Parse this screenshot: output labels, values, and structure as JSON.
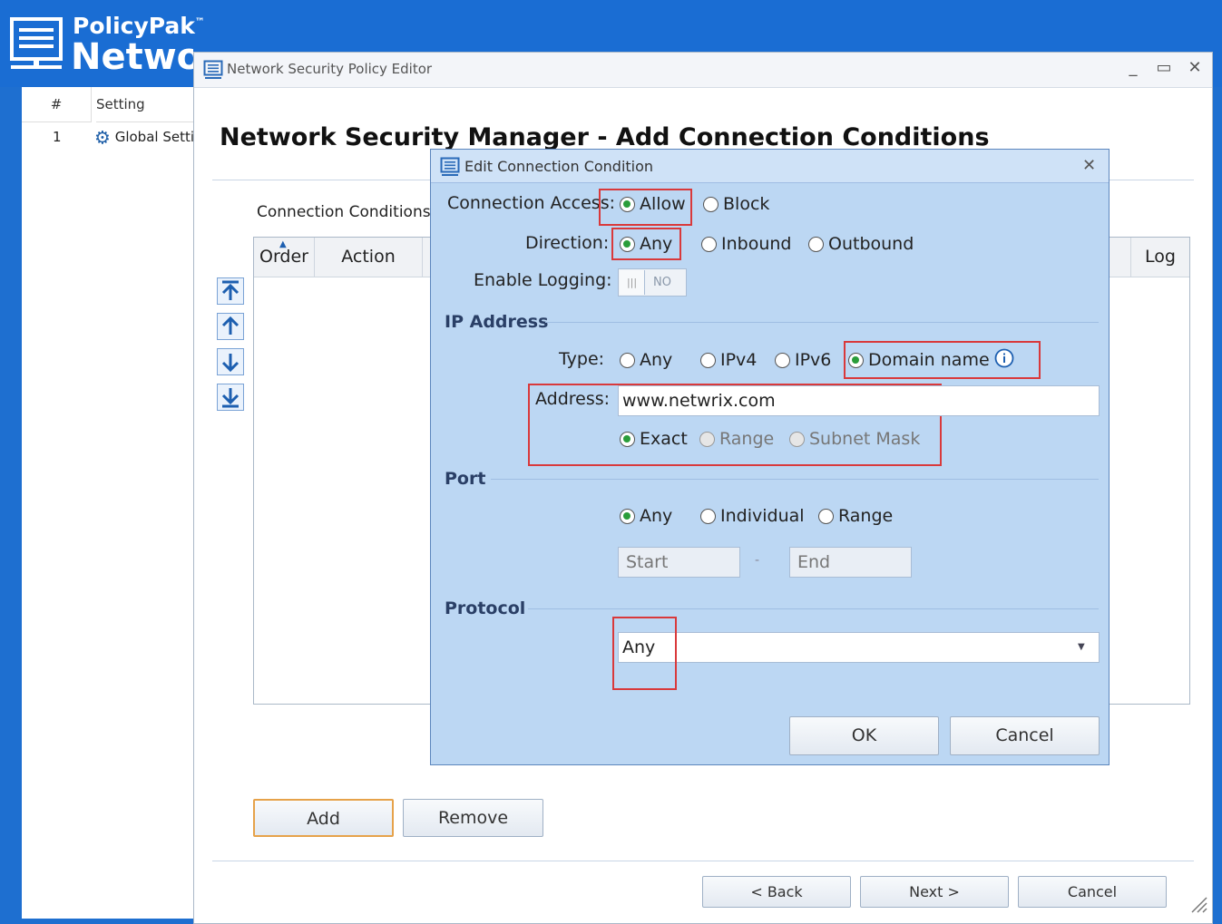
{
  "app": {
    "brand": "PolicyPak",
    "brand_tm": "™",
    "title": "Network Security Manager",
    "table_headers": [
      "#",
      "Setting"
    ],
    "row_number": "1",
    "row_setting": "Global Settings"
  },
  "window": {
    "title": "Network Security Policy Editor",
    "minimize": "_",
    "maximize": "▭",
    "close": "✕",
    "heading": "Network Security Manager - Add Connection Conditions",
    "conditions_label": "Connection Conditions",
    "columns": [
      "Order",
      "Action",
      "Log"
    ],
    "add_label": "Add",
    "remove_label": "Remove",
    "back_label": "<  Back",
    "next_label": "Next  >",
    "cancel_label": "Cancel"
  },
  "dialog": {
    "title": "Edit Connection Condition",
    "close": "✕",
    "access_label": "Connection Access:",
    "access_options": [
      "Allow",
      "Block"
    ],
    "direction_label": "Direction:",
    "direction_options": [
      "Any",
      "Inbound",
      "Outbound"
    ],
    "logging_label": "Enable Logging:",
    "logging_toggle": "NO",
    "ip_section": "IP Address",
    "type_label": "Type:",
    "type_options": [
      "Any",
      "IPv4",
      "IPv6",
      "Domain name"
    ],
    "address_label": "Address:",
    "address_value": "www.netwrix.com",
    "match_options": [
      "Exact",
      "Range",
      "Subnet Mask"
    ],
    "port_section": "Port",
    "port_options": [
      "Any",
      "Individual",
      "Range"
    ],
    "port_start_placeholder": "Start",
    "port_end_placeholder": "End",
    "port_dash": "-",
    "protocol_section": "Protocol",
    "protocol_value": "Any",
    "ok_label": "OK",
    "cancel_label": "Cancel"
  },
  "colors": {
    "highlight": "#d9393b",
    "dialog_bg": "#bcd7f3",
    "brand_blue": "#1a6dd3"
  }
}
